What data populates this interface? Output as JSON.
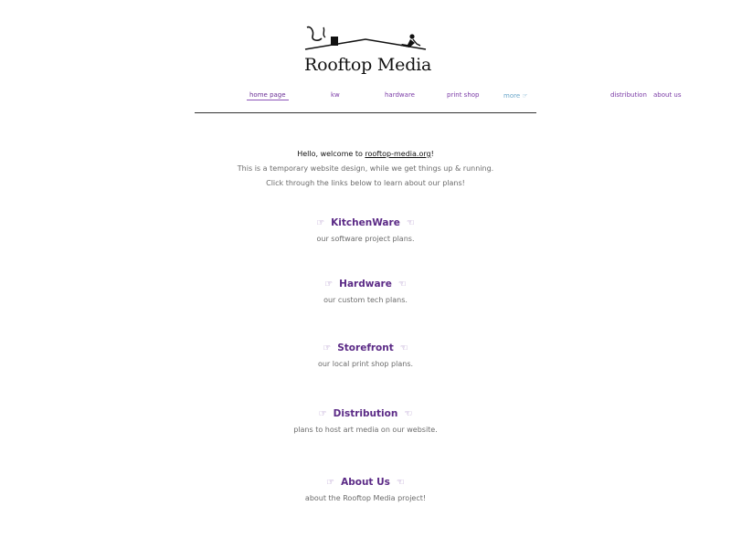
{
  "logo": {
    "text": "Rooftop Media",
    "icon": "rooftop-logo"
  },
  "nav": {
    "home": "home page",
    "kw": "kw",
    "hardware": "hardware",
    "print_shop": "print shop",
    "more": "more ☞",
    "distribution": "distribution",
    "about": "about us"
  },
  "intro": {
    "greeting_prefix": "Hello, welcome to ",
    "site_link": "rooftop-media.org",
    "greeting_suffix": "!",
    "line2": "This is a temporary website design, while we get things up & running.",
    "line3": "Click through the links below to learn about our plans!"
  },
  "hands": {
    "right": "☞",
    "left": "☜"
  },
  "sections": [
    {
      "title": "KitchenWare",
      "desc": "our software project plans."
    },
    {
      "title": "Hardware",
      "desc": "our custom tech plans."
    },
    {
      "title": "Storefront",
      "desc": "our local print shop plans."
    },
    {
      "title": "Distribution",
      "desc": "plans to host art media on our website."
    },
    {
      "title": "About Us",
      "desc": "about the Rooftop Media project!"
    }
  ],
  "colors": {
    "heading": "#5b2a86",
    "nav": "#7a3aa6",
    "more": "#6aa6c9",
    "body_grey": "#6b6b6b"
  }
}
